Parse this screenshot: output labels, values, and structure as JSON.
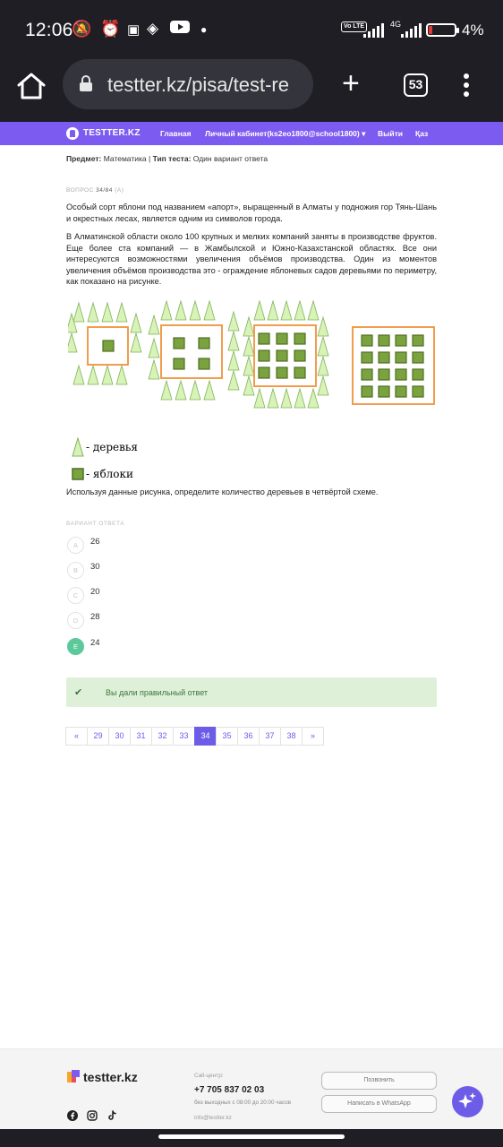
{
  "status_bar": {
    "time": "12:06",
    "battery_pct": "4%",
    "net_type": "4G",
    "volte": "Vo LTE",
    "battery_level": 0.04
  },
  "browser": {
    "url": "testter.kz/pisa/test-re",
    "tab_count": "53"
  },
  "nav": {
    "brand": "TESTTER.KZ",
    "links": [
      "Главная",
      "Личный кабинет(ks2eo1800@school1800)",
      "Выйти",
      "Қаз"
    ],
    "dropdown_caret": "▾"
  },
  "meta": {
    "subject_label": "Предмет:",
    "subject": "Математика",
    "separator": "|",
    "type_label": "Тип теста:",
    "type": "Один вариант ответа"
  },
  "question": {
    "label": "ВОПРОС",
    "number": "34/84",
    "suffix": "(A)",
    "paragraph1": "Особый сорт яблони под названием «апорт», выращенный в Алматы у подножия гор Тянь-Шань и окрестных лесах, является одним из символов города.",
    "paragraph2": "В Алматинской области около 100 крупных и мелких компаний заняты в производстве фруктов. Еще более ста компаний — в Жамбылской и Южно-Казахстанской областях. Все они интересуются возможностями увеличения объёмов производства. Один из моментов увеличения объёмов производства это - ограждение яблоневых садов деревьями по периметру, как показано на рисунке.",
    "legend_trees": "- деревья",
    "legend_apples": "- яблоки",
    "prompt": "Используя данные рисунка, определите количество деревьев в четвёртой схеме."
  },
  "options": {
    "title": "ВАРИАНТ ОТВЕТА",
    "items": [
      {
        "letter": "A",
        "value": "26",
        "selected": false
      },
      {
        "letter": "B",
        "value": "30",
        "selected": false
      },
      {
        "letter": "C",
        "value": "20",
        "selected": false
      },
      {
        "letter": "D",
        "value": "28",
        "selected": false
      },
      {
        "letter": "E",
        "value": "24",
        "selected": true
      }
    ]
  },
  "alert": {
    "icon": "check-icon",
    "message": "Вы дали правильный ответ"
  },
  "pagination": {
    "items": [
      "«",
      "29",
      "30",
      "31",
      "32",
      "33",
      "34",
      "35",
      "36",
      "37",
      "38",
      "»"
    ],
    "active": "34"
  },
  "footer": {
    "brand": "testter.kz",
    "callcenter_label": "Call-центр:",
    "phone": "+7 705 837 02 03",
    "hours": "без выходных с 08:00 до 20:00 часов",
    "email": "info@testter.kz",
    "call_button": "Позвонить",
    "whatsapp_button": "Написать в WhatsApp",
    "social_icons": [
      "facebook-icon",
      "instagram-icon",
      "tiktok-icon"
    ]
  },
  "colors": {
    "accent": "#7c5cf0",
    "tree_fill": "#d9f2b8",
    "tree_stroke": "#7fb45a",
    "apple_fill": "#7aa33f",
    "apple_stroke": "#4f6f22",
    "frame": "#f0923a",
    "success": "#5bc99a"
  }
}
